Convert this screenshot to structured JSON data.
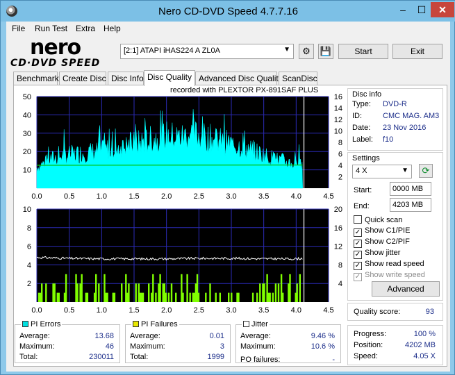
{
  "window": {
    "title": "Nero CD-DVD Speed 4.7.7.16",
    "min": "–",
    "max": "☐",
    "close": "✕"
  },
  "menu": [
    "File",
    "Run Test",
    "Extra",
    "Help"
  ],
  "logo": {
    "brand": "nero",
    "sub": "CD·DVD SPEED"
  },
  "drive": {
    "selected": "[2:1]   ATAPI iHAS224   A ZL0A"
  },
  "toolbar": {
    "start": "Start",
    "exit": "Exit"
  },
  "tabs": [
    "Benchmark",
    "Create Disc",
    "Disc Info",
    "Disc Quality",
    "Advanced Disc Quality",
    "ScanDisc"
  ],
  "active_tab": "Disc Quality",
  "recorded_with": "recorded with PLEXTOR  PX-891SAF PLUS",
  "disc_info": {
    "title": "Disc info",
    "type_label": "Type:",
    "type": "DVD-R",
    "id_label": "ID:",
    "id": "CMC MAG. AM3",
    "date_label": "Date:",
    "date": "23 Nov 2016",
    "label_label": "Label:",
    "label": "f10"
  },
  "settings": {
    "title": "Settings",
    "speed": "4 X",
    "start_label": "Start:",
    "start": "0000 MB",
    "end_label": "End:",
    "end": "4203 MB",
    "checks": [
      {
        "label": "Quick scan",
        "checked": false,
        "disabled": false
      },
      {
        "label": "Show C1/PIE",
        "checked": true,
        "disabled": false
      },
      {
        "label": "Show C2/PIF",
        "checked": true,
        "disabled": false
      },
      {
        "label": "Show jitter",
        "checked": true,
        "disabled": false
      },
      {
        "label": "Show read speed",
        "checked": true,
        "disabled": false
      },
      {
        "label": "Show write speed",
        "checked": true,
        "disabled": true
      }
    ],
    "advanced": "Advanced"
  },
  "quality": {
    "label": "Quality score:",
    "value": "93"
  },
  "progress": {
    "progress_label": "Progress:",
    "progress": "100 %",
    "position_label": "Position:",
    "position": "4202 MB",
    "speed_label": "Speed:",
    "speed": "4.05 X"
  },
  "pi_errors": {
    "title": "PI Errors",
    "color": "#00e0e0",
    "avg_label": "Average:",
    "avg": "13.68",
    "max_label": "Maximum:",
    "max": "46",
    "total_label": "Total:",
    "total": "230011"
  },
  "pi_failures": {
    "title": "PI Failures",
    "color": "#e8e800",
    "avg_label": "Average:",
    "avg": "0.01",
    "max_label": "Maximum:",
    "max": "3",
    "total_label": "Total:",
    "total": "1999"
  },
  "jitter": {
    "title": "Jitter",
    "color": "#ffffff",
    "avg_label": "Average:",
    "avg": "9.46 %",
    "max_label": "Maximum:",
    "max": "10.6 %",
    "pof_label": "PO failures:",
    "pof": "-"
  },
  "chart_data": [
    {
      "type": "area",
      "name": "PI Errors",
      "x_ticks": [
        "0.0",
        "0.5",
        "1.0",
        "1.5",
        "2.0",
        "2.5",
        "3.0",
        "3.5",
        "4.0",
        "4.5"
      ],
      "y_left_ticks": [
        "10",
        "20",
        "30",
        "40",
        "50"
      ],
      "y_right_ticks": [
        "2",
        "4",
        "6",
        "8",
        "10",
        "12",
        "14",
        "16"
      ],
      "xlim": [
        0,
        4.5
      ],
      "ylim_left": [
        0,
        50
      ],
      "ylim_right": [
        0,
        16
      ],
      "series": [
        {
          "name": "PI Errors",
          "color": "#00ffff",
          "x": [
            0.0,
            0.2,
            0.4,
            0.6,
            0.8,
            1.0,
            1.2,
            1.4,
            1.6,
            1.8,
            2.0,
            2.2,
            2.4,
            2.6,
            2.8,
            3.0,
            3.2,
            3.4,
            3.6,
            3.8,
            4.0,
            4.1
          ],
          "values": [
            12,
            17,
            19,
            20,
            21,
            22,
            24,
            25,
            27,
            29,
            31,
            30,
            32,
            30,
            28,
            26,
            24,
            21,
            18,
            16,
            14,
            13
          ]
        },
        {
          "name": "Read speed",
          "color": "#00c000",
          "x": [
            0.0,
            4.1
          ],
          "values": [
            4.0,
            4.05
          ]
        }
      ]
    },
    {
      "type": "bar",
      "name": "PI Failures",
      "x_ticks": [
        "0.0",
        "0.5",
        "1.0",
        "1.5",
        "2.0",
        "2.5",
        "3.0",
        "3.5",
        "4.0",
        "4.5"
      ],
      "y_left_ticks": [
        "2",
        "4",
        "6",
        "8",
        "10"
      ],
      "y_right_ticks": [
        "4",
        "8",
        "12",
        "16",
        "20"
      ],
      "xlim": [
        0,
        4.5
      ],
      "ylim_left": [
        0,
        10
      ],
      "ylim_right": [
        0,
        20
      ],
      "series": [
        {
          "name": "PI Failures",
          "color": "#80ff00",
          "max": 3
        },
        {
          "name": "Jitter",
          "color": "#ffffff",
          "x": [
            0.0,
            0.5,
            1.0,
            1.5,
            2.0,
            2.5,
            3.0,
            3.5,
            4.0,
            4.1
          ],
          "values": [
            9.6,
            9.4,
            9.3,
            9.3,
            9.3,
            9.4,
            9.4,
            9.3,
            9.3,
            9.4
          ]
        }
      ]
    }
  ]
}
